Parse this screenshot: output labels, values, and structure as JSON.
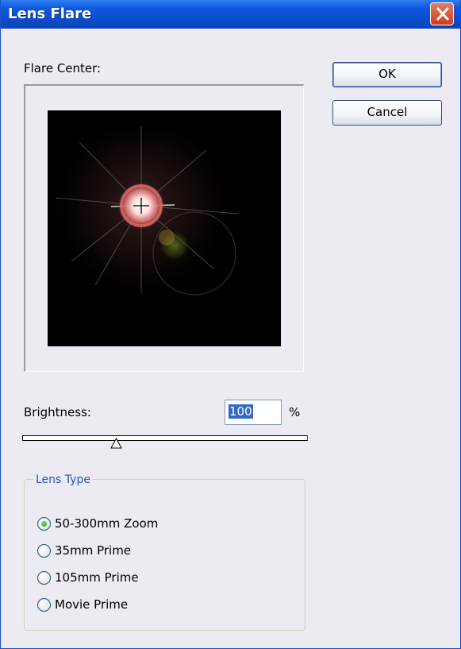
{
  "window": {
    "title": "Lens Flare"
  },
  "preview": {
    "label": "Flare Center:"
  },
  "buttons": {
    "ok": "OK",
    "cancel": "Cancel"
  },
  "brightness": {
    "label": "Brightness:",
    "value": "100",
    "unit": "%",
    "slider_fraction": 0.33
  },
  "lens_type": {
    "legend": "Lens Type",
    "options": [
      {
        "label": "50-300mm Zoom",
        "selected": true
      },
      {
        "label": "35mm Prime",
        "selected": false
      },
      {
        "label": "105mm Prime",
        "selected": false
      },
      {
        "label": "Movie Prime",
        "selected": false
      }
    ]
  },
  "colors": {
    "titlebar": "#0a4ccc",
    "dialog_bg": "#ecebf1",
    "accent": "#2054c6",
    "selection": "#316ac5"
  }
}
